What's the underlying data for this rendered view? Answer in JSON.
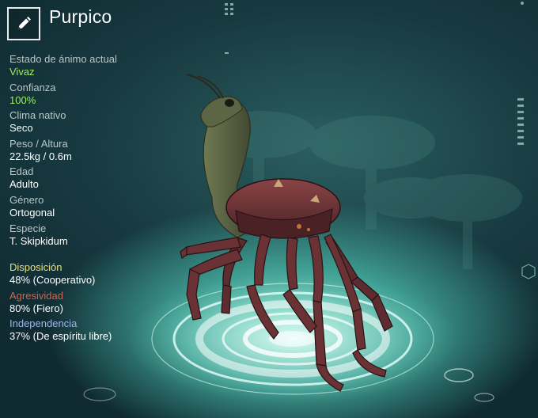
{
  "creature": {
    "name": "Purpico"
  },
  "icons": {
    "edit": "pencil-icon"
  },
  "stats": [
    {
      "label": "Estado de ánimo actual",
      "value": "Vivaz",
      "highlight": true
    },
    {
      "label": "Confianza",
      "value": "100%",
      "highlight": true
    },
    {
      "label": "Clima nativo",
      "value": "Seco",
      "highlight": false
    },
    {
      "label": "Peso / Altura",
      "value": "22.5kg / 0.6m",
      "highlight": false
    },
    {
      "label": "Edad",
      "value": "Adulto",
      "highlight": false
    },
    {
      "label": "Género",
      "value": "Ortogonal",
      "highlight": false
    },
    {
      "label": "Especie",
      "value": "T. Skipkidum",
      "highlight": false
    }
  ],
  "traits": [
    {
      "label": "Disposición",
      "value": "48% (Cooperativo)",
      "color": "#e9e07a"
    },
    {
      "label": "Agresividad",
      "value": "80% (Fiero)",
      "color": "#d4624e"
    },
    {
      "label": "Independencia",
      "value": "37% (De espíritu libre)",
      "color": "#9fb6e8"
    }
  ],
  "colors": {
    "highlight": "#9af05a",
    "text": "#ffffff",
    "label": "#b9c7c9"
  }
}
